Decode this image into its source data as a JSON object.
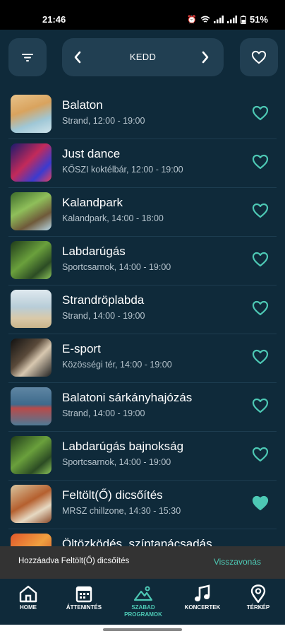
{
  "status_bar": {
    "time": "21:46",
    "battery": "51%"
  },
  "header": {
    "day": "KEDD"
  },
  "events": [
    {
      "title": "Balaton",
      "subtitle": "Strand, 12:00 - 19:00",
      "favorited": false
    },
    {
      "title": "Just dance",
      "subtitle": "KŐSZI koktélbár, 12:00 - 19:00",
      "favorited": false
    },
    {
      "title": "Kalandpark",
      "subtitle": "Kalandpark, 14:00 - 18:00",
      "favorited": false
    },
    {
      "title": "Labdarúgás",
      "subtitle": "Sportcsarnok, 14:00 - 19:00",
      "favorited": false
    },
    {
      "title": "Strandröplabda",
      "subtitle": "Strand, 14:00 - 19:00",
      "favorited": false
    },
    {
      "title": "E-sport",
      "subtitle": "Közösségi tér, 14:00 - 19:00",
      "favorited": false
    },
    {
      "title": "Balatoni sárkányhajózás",
      "subtitle": "Strand, 14:00 - 19:00",
      "favorited": false
    },
    {
      "title": "Labdarúgás bajnokság",
      "subtitle": "Sportcsarnok, 14:00 - 19:00",
      "favorited": false
    },
    {
      "title": "Feltölt(Ő) dicsőítés",
      "subtitle": "MRSZ chillzone, 14:30 - 15:30",
      "favorited": true
    },
    {
      "title": "Öltözködés, színtanácsadás",
      "subtitle": "",
      "favorited": false
    }
  ],
  "toast": {
    "message": "Hozzáadva Feltölt(Ő) dicsőítés",
    "action": "Visszavonás"
  },
  "nav": {
    "home": "HOME",
    "attentions": "ÁTTENINTÉS",
    "programs_line1": "SZABAD",
    "programs_line2": "PROGRAMOK",
    "concerts": "KONCERTEK",
    "map": "TÉRKÉP"
  },
  "colors": {
    "accent": "#4dc8b4",
    "background": "#0f2a3a",
    "pill": "#213f52"
  }
}
